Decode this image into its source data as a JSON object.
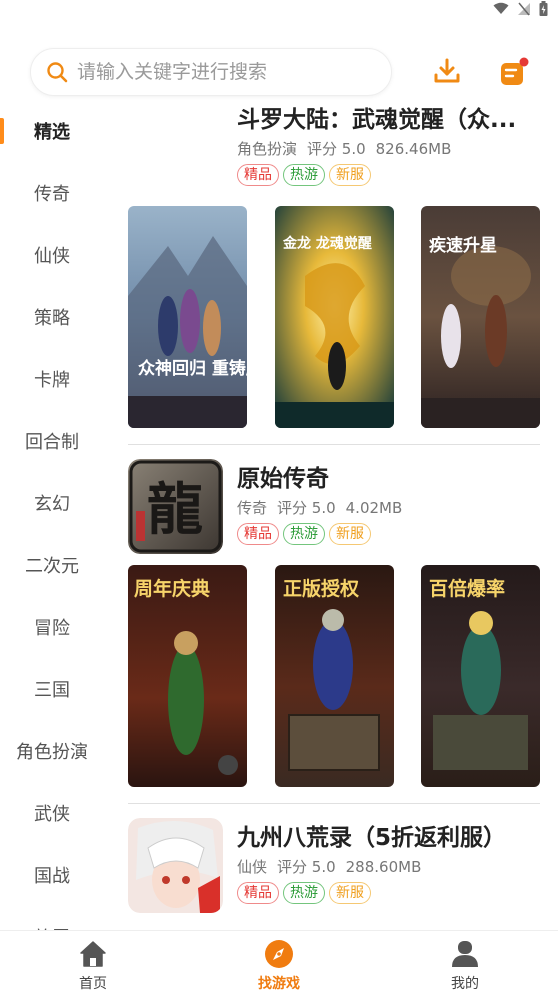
{
  "search": {
    "placeholder": "请输入关键字进行搜索"
  },
  "icons": {
    "search": "search-icon",
    "download": "download-icon",
    "message": "message-icon",
    "home": "home-icon",
    "discover": "compass-icon",
    "profile": "user-icon"
  },
  "colors": {
    "accent": "#ff8c1a",
    "tag_red": "#e53935",
    "tag_green": "#2e9d3a",
    "tag_orange": "#f0a020"
  },
  "sidebar": {
    "items": [
      {
        "label": "精选"
      },
      {
        "label": "传奇"
      },
      {
        "label": "仙侠"
      },
      {
        "label": "策略"
      },
      {
        "label": "卡牌"
      },
      {
        "label": "回合制"
      },
      {
        "label": "玄幻"
      },
      {
        "label": "二次元"
      },
      {
        "label": "冒险"
      },
      {
        "label": "三国"
      },
      {
        "label": "角色扮演"
      },
      {
        "label": "武侠"
      },
      {
        "label": "国战"
      },
      {
        "label": "放置"
      }
    ]
  },
  "games": [
    {
      "title": "斗罗大陆：武魂觉醒（众...",
      "genre": "角色扮演",
      "rating": "评分 5.0",
      "size": "826.46MB",
      "tags": [
        "精品",
        "热游",
        "新服"
      ],
      "shots": [
        {
          "text": "众神回归 重铸唐门"
        },
        {
          "text": "金龙 龙魂觉醒"
        },
        {
          "text": "疾速升星"
        }
      ]
    },
    {
      "title": "原始传奇",
      "genre": "传奇",
      "rating": "评分 5.0",
      "size": "4.02MB",
      "icon_text": "龍",
      "tags": [
        "精品",
        "热游",
        "新服"
      ],
      "shots": [
        {
          "text": "周年庆典"
        },
        {
          "text": "正版授权"
        },
        {
          "text": "百倍爆率"
        }
      ]
    },
    {
      "title": "九州八荒录（5折返利服）",
      "genre": "仙侠",
      "rating": "评分 5.0",
      "size": "288.60MB",
      "tags": [
        "精品",
        "热游",
        "新服"
      ]
    }
  ],
  "nav": {
    "home": "首页",
    "discover": "找游戏",
    "profile": "我的"
  }
}
